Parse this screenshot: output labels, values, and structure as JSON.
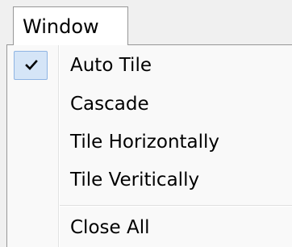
{
  "menubar": {
    "title": "Window"
  },
  "menu": {
    "items": [
      {
        "label": "Auto Tile",
        "checked": true
      },
      {
        "label": "Cascade",
        "checked": false
      },
      {
        "label": "Tile Horizontally",
        "checked": false
      },
      {
        "label": "Tile Veritically",
        "checked": false
      },
      {
        "label": "Close All",
        "checked": false
      }
    ]
  },
  "icons": {
    "check": "check-icon"
  },
  "colors": {
    "checked_highlight": "#d5e5f7",
    "checked_border": "#8fb4e3",
    "menu_background": "#f9f9f9",
    "border": "#979797"
  }
}
